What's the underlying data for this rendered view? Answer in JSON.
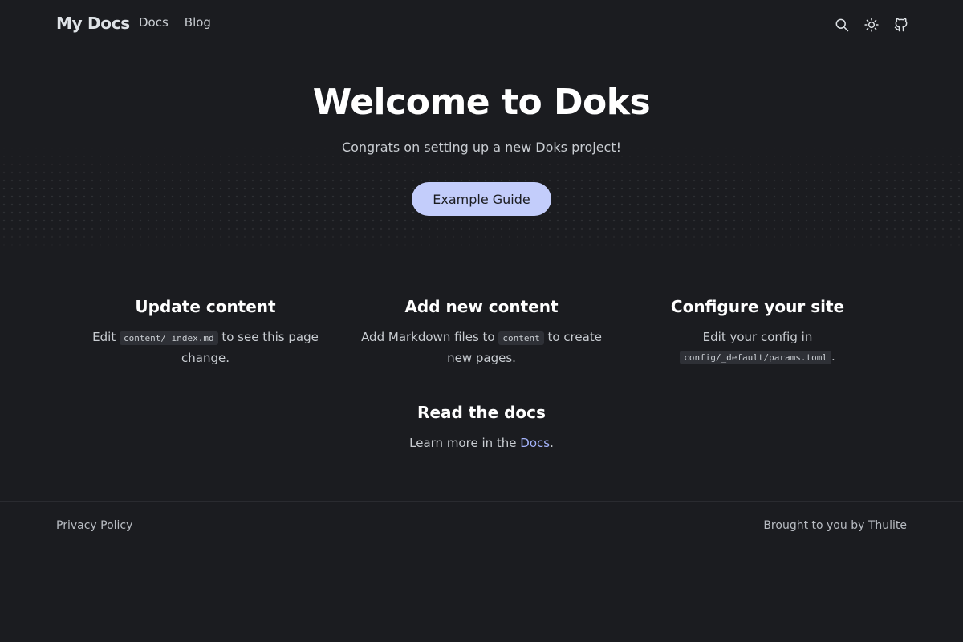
{
  "header": {
    "brand": "My Docs",
    "nav": [
      {
        "label": "Docs"
      },
      {
        "label": "Blog"
      }
    ],
    "icons": [
      "search-icon",
      "sun-icon",
      "github-icon"
    ]
  },
  "hero": {
    "title": "Welcome to Doks",
    "subtitle": "Congrats on setting up a new Doks project!",
    "button_label": "Example Guide"
  },
  "features": [
    {
      "title": "Update content",
      "text_before": "Edit ",
      "code": "content/_index.md",
      "text_after": " to see this page change."
    },
    {
      "title": "Add new content",
      "text_before": "Add Markdown files to ",
      "code": "content",
      "text_after": " to create new pages."
    },
    {
      "title": "Configure your site",
      "text_before": "Edit your config in ",
      "code": "config/_default/params.toml",
      "text_after": "."
    },
    {
      "title": "Read the docs",
      "text_before": "Learn more in the ",
      "link": "Docs",
      "text_after": "."
    }
  ],
  "footer": {
    "left": "Privacy Policy",
    "right": "Brought to you by Thulite"
  },
  "colors": {
    "background": "#1b1c20",
    "accent": "#c3cdfb",
    "link": "#a5b4fc"
  }
}
